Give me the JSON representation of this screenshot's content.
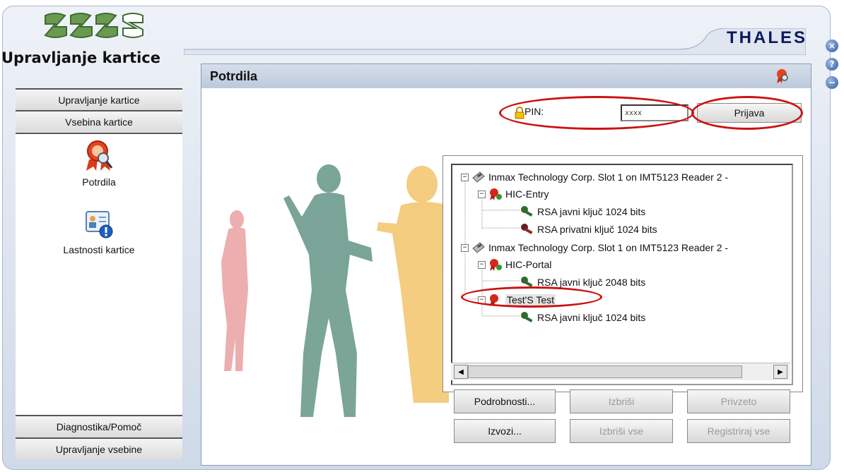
{
  "app": {
    "title": "Upravljanje kartice",
    "brand": "THALES"
  },
  "window_buttons": {
    "close": "×",
    "help": "?",
    "minimize": "−"
  },
  "sidebar": {
    "top_items": [
      {
        "label": "Upravljanje kartice"
      },
      {
        "label": "Vsebina kartice"
      }
    ],
    "panel_items": [
      {
        "label": "Potrdila",
        "icon": "certificate-icon"
      },
      {
        "label": "Lastnosti kartice",
        "icon": "card-properties-icon"
      }
    ],
    "bottom_items": [
      {
        "label": "Diagnostika/Pomoč"
      },
      {
        "label": "Upravljanje vsebine"
      }
    ]
  },
  "main": {
    "title": "Potrdila",
    "pin": {
      "label": "PIN:",
      "value": "xxxx"
    },
    "login_button": "Prijava",
    "tree": [
      {
        "label": "Inmax Technology Corp. Slot 1 on IMT5123 Reader 2 -",
        "type": "reader"
      },
      {
        "label": "HIC-Entry",
        "type": "certificate"
      },
      {
        "label": "RSA javni ključ 1024 bits",
        "type": "public-key"
      },
      {
        "label": "RSA privatni ključ 1024 bits",
        "type": "private-key"
      },
      {
        "label": "Inmax Technology Corp. Slot 1 on IMT5123 Reader 2 -",
        "type": "reader"
      },
      {
        "label": "HIC-Portal",
        "type": "certificate"
      },
      {
        "label": "RSA javni ključ 2048 bits",
        "type": "public-key"
      },
      {
        "label": "Test'S Test",
        "type": "certificate"
      },
      {
        "label": "RSA javni ključ 1024 bits",
        "type": "public-key"
      }
    ],
    "buttons": {
      "details": "Podrobnosti...",
      "delete": "Izbriši",
      "default": "Privzeto",
      "export": "Izvozi...",
      "delete_all": "Izbriši vse",
      "register_all": "Registriraj vse"
    }
  },
  "colors": {
    "highlight": "#cc1111",
    "brand": "#0d1a5e",
    "header": "#c8d3e3"
  }
}
